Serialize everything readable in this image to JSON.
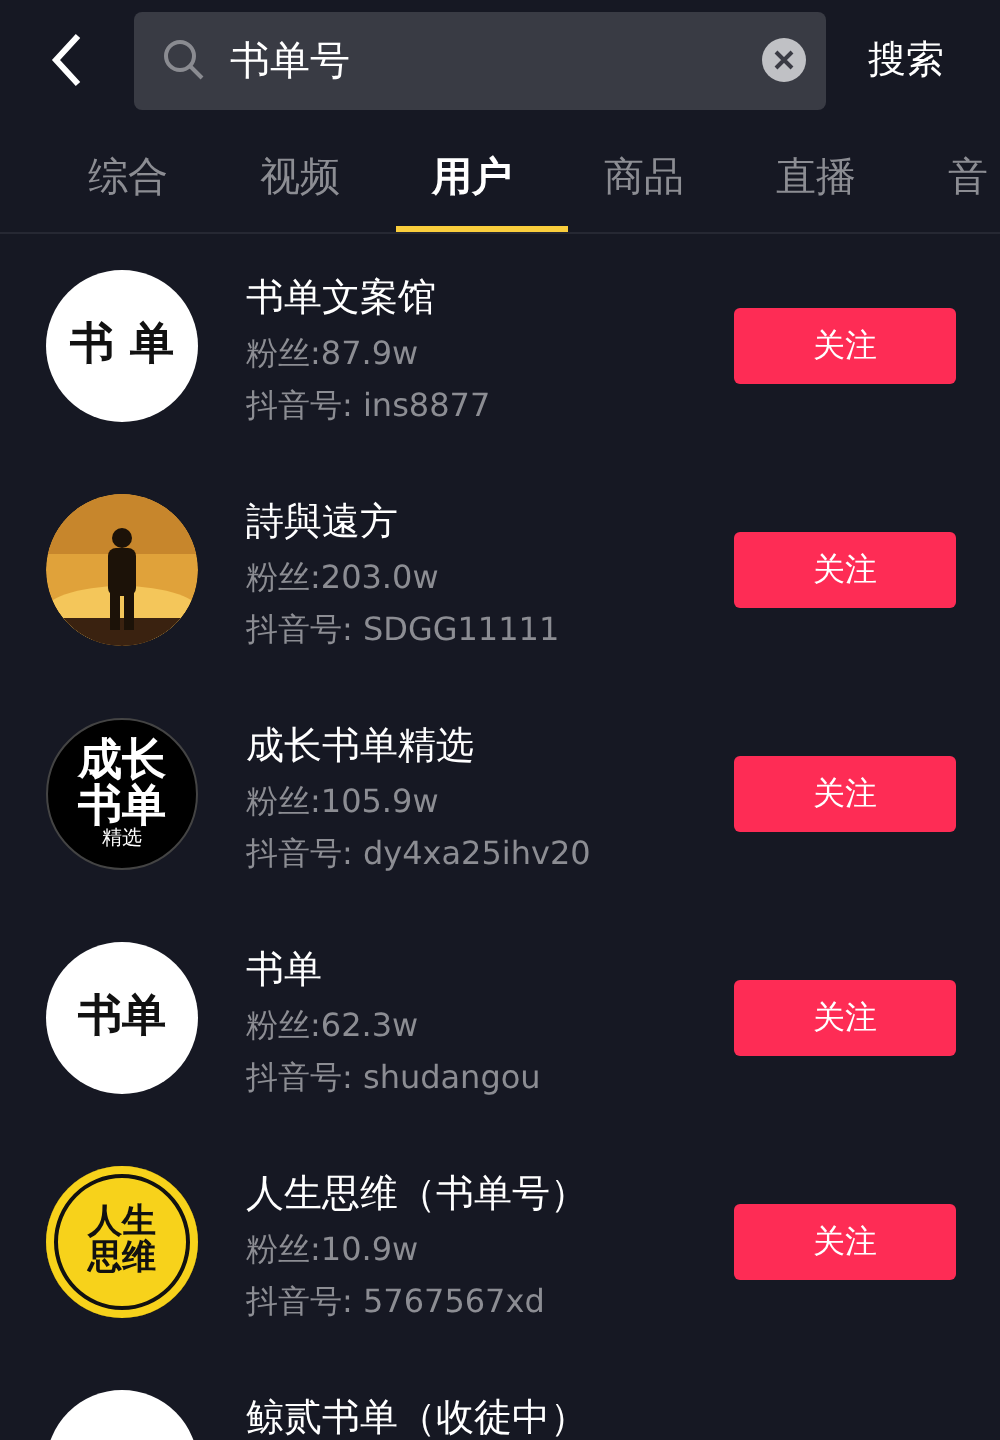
{
  "search": {
    "value": "书单号",
    "action": "搜索"
  },
  "tabs": [
    {
      "label": "综合",
      "selected": false
    },
    {
      "label": "视频",
      "selected": false
    },
    {
      "label": "用户",
      "selected": true
    },
    {
      "label": "商品",
      "selected": false
    },
    {
      "label": "直播",
      "selected": false
    },
    {
      "label": "音",
      "selected": false
    }
  ],
  "users": [
    {
      "name": "书单文案馆",
      "fans": "粉丝:87.9w",
      "account": "抖音号: ins8877",
      "follow": "关注",
      "avatar": {
        "kind": "white",
        "lines": [
          "书 单"
        ]
      }
    },
    {
      "name": "詩與遠方",
      "fans": "粉丝:203.0w",
      "account": "抖音号: SDGG11111",
      "follow": "关注"
    },
    {
      "name": "成长书单精选",
      "fans": "粉丝:105.9w",
      "account": "抖音号: dy4xa25ihv20",
      "follow": "关注",
      "avatar": {
        "kind": "black",
        "lines": [
          "成长",
          "书单"
        ],
        "small": "精选"
      }
    },
    {
      "name": "书单",
      "fans": "粉丝:62.3w",
      "account": "抖音号: shudangou",
      "follow": "关注",
      "avatar": {
        "kind": "white",
        "lines": [
          "书单"
        ]
      }
    },
    {
      "name": "人生思维（书单号）",
      "fans": "粉丝:10.9w",
      "account": "抖音号: 5767567xd",
      "follow": "关注",
      "avatar": {
        "kind": "yellow",
        "lines": [
          "人生",
          "思维"
        ]
      }
    },
    {
      "name": "鲸贰书单（收徒中）",
      "avatar": {
        "kind": "white"
      }
    }
  ]
}
